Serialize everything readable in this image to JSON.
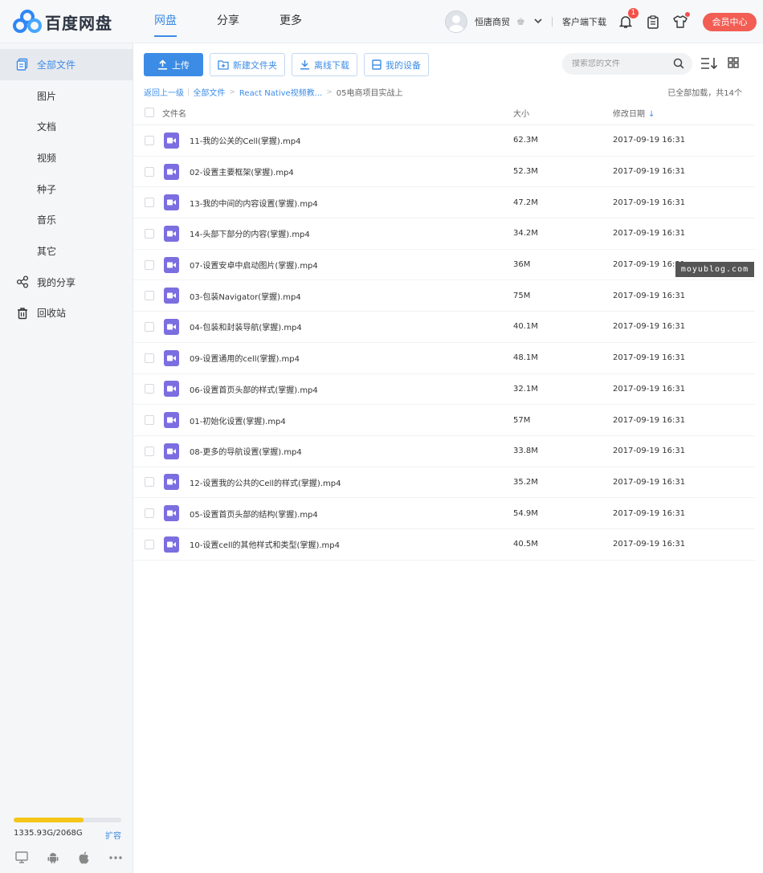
{
  "app": {
    "logo_text": "百度网盘"
  },
  "nav": {
    "items": [
      "网盘",
      "分享",
      "更多"
    ],
    "active": 0
  },
  "user": {
    "name": "恒唐商贸",
    "client_download": "客户端下载",
    "notification_count": "1",
    "vip_label": "会员中心"
  },
  "sidebar": {
    "items": [
      {
        "label": "全部文件",
        "icon": "folder-icon"
      },
      {
        "label": "图片"
      },
      {
        "label": "文档"
      },
      {
        "label": "视频"
      },
      {
        "label": "种子"
      },
      {
        "label": "音乐"
      },
      {
        "label": "其它"
      },
      {
        "label": "我的分享",
        "icon": "share-icon"
      },
      {
        "label": "回收站",
        "icon": "trash-icon"
      }
    ],
    "quota": {
      "text": "1335.93G/2068G",
      "fraction": 0.646,
      "expand_label": "扩容"
    }
  },
  "toolbar": {
    "upload": "上传",
    "new_folder": "新建文件夹",
    "offline_download": "离线下载",
    "my_devices": "我的设备",
    "search_placeholder": "搜索您的文件"
  },
  "breadcrumb": {
    "back": "返回上一级",
    "all_files": "全部文件",
    "parent": "React Native视频教...",
    "current": "05电商项目实战上"
  },
  "loaded_status": "已全部加载，共14个",
  "table": {
    "headers": {
      "name": "文件名",
      "size": "大小",
      "date": "修改日期"
    },
    "rows": [
      {
        "name": "11-我的公关的Cell(掌握).mp4",
        "size": "62.3M",
        "date": "2017-09-19 16:31"
      },
      {
        "name": "02-设置主要框架(掌握).mp4",
        "size": "52.3M",
        "date": "2017-09-19 16:31"
      },
      {
        "name": "13-我的中间的内容设置(掌握).mp4",
        "size": "47.2M",
        "date": "2017-09-19 16:31"
      },
      {
        "name": "14-头部下部分的内容(掌握).mp4",
        "size": "34.2M",
        "date": "2017-09-19 16:31"
      },
      {
        "name": "07-设置安卓中启动图片(掌握).mp4",
        "size": "36M",
        "date": "2017-09-19 16:31"
      },
      {
        "name": "03-包装Navigator(掌握).mp4",
        "size": "75M",
        "date": "2017-09-19 16:31"
      },
      {
        "name": "04-包装和封装导航(掌握).mp4",
        "size": "40.1M",
        "date": "2017-09-19 16:31"
      },
      {
        "name": "09-设置通用的cell(掌握).mp4",
        "size": "48.1M",
        "date": "2017-09-19 16:31"
      },
      {
        "name": "06-设置首页头部的样式(掌握).mp4",
        "size": "32.1M",
        "date": "2017-09-19 16:31"
      },
      {
        "name": "01-初始化设置(掌握).mp4",
        "size": "57M",
        "date": "2017-09-19 16:31"
      },
      {
        "name": "08-更多的导航设置(掌握).mp4",
        "size": "33.8M",
        "date": "2017-09-19 16:31"
      },
      {
        "name": "12-设置我的公共的Cell的样式(掌握).mp4",
        "size": "35.2M",
        "date": "2017-09-19 16:31"
      },
      {
        "name": "05-设置首页头部的结构(掌握).mp4",
        "size": "54.9M",
        "date": "2017-09-19 16:31"
      },
      {
        "name": "10-设置cell的其他样式和类型(掌握).mp4",
        "size": "40.5M",
        "date": "2017-09-19 16:31"
      }
    ]
  },
  "watermark": "moyublog.com",
  "colors": {
    "accent": "#3c8ce6",
    "vip": "#f25d54",
    "video_icon": "#7b6ee0",
    "quota_fill": "#f5c518"
  }
}
